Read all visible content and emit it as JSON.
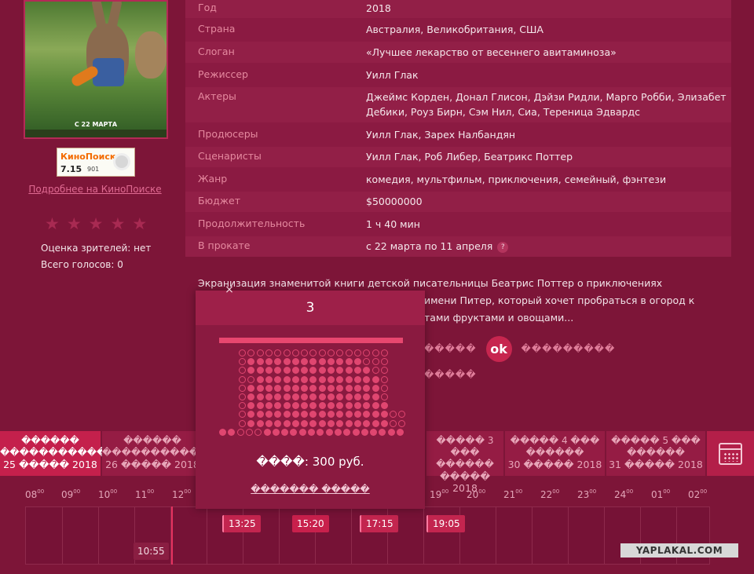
{
  "poster": {
    "date_text": "С 22 МАРТА"
  },
  "kinopoisk": {
    "brand": "КиноПоиск",
    "rating": "7.15",
    "votes": "901",
    "link_label": "Подробнее на КиноПоиске"
  },
  "audience": {
    "stars_total": 5,
    "stars_filled": 0,
    "rating_label": "Оценка зрителей: нет",
    "votes_label": "Всего голосов: 0"
  },
  "info": [
    {
      "label": "Год",
      "value": "2018"
    },
    {
      "label": "Страна",
      "value": "Австралия, Великобритания, США"
    },
    {
      "label": "Слоган",
      "value": "«Лучшее лекарство от весеннего авитаминоза»"
    },
    {
      "label": "Режиссер",
      "value": "Уилл Глак"
    },
    {
      "label": "Актеры",
      "value": "Джеймс Корден, Донал Глисон, Дэйзи Ридли, Марго Робби, Элизабет Дебики, Роуз Бирн, Сэм Нил, Сиа, Тереница Эдвардс"
    },
    {
      "label": "Продюсеры",
      "value": "Уилл Глак, Зарех Налбандян"
    },
    {
      "label": "Сценаристы",
      "value": "Уилл Глак, Роб Либер, Беатрикс Поттер"
    },
    {
      "label": "Жанр",
      "value": "комедия, мультфильм, приключения, семейный, фэнтези"
    },
    {
      "label": "Бюджет",
      "value": "$50000000"
    },
    {
      "label": "Продолжительность",
      "value": "1 ч 40 мин"
    },
    {
      "label": "В прокате",
      "value": "с 22 марта по 11 апреля"
    }
  ],
  "help_badge": "?",
  "description": {
    "line1": "Экранизация знаменитой книги детской писательницы Беатрис Поттер о приключениях",
    "line2": "имени Питер, который хочет пробраться в огород к",
    "line3": "тами фруктами и овощами..."
  },
  "share": {
    "left": "�����",
    "right": "���������",
    "second": "�����",
    "ok_icon": "ok-icon"
  },
  "dates": [
    {
      "top": "������",
      "mid": "�����������",
      "date": "25 ����� 2018",
      "active": true
    },
    {
      "top": "������",
      "mid": "�����������",
      "date": "26 ����� 2018",
      "active": false
    },
    {
      "top": "����� 3 ���",
      "mid": "������",
      "date": "����� 2018",
      "active": false
    },
    {
      "top": "����� 4 ���",
      "mid": "������",
      "date": "30 ����� 2018",
      "active": false
    },
    {
      "top": "����� 5 ���",
      "mid": "������",
      "date": "31 ����� 2018",
      "active": false
    }
  ],
  "hours": [
    "08",
    "09",
    "10",
    "11",
    "12",
    "19",
    "20",
    "21",
    "22",
    "23",
    "24",
    "01",
    "02"
  ],
  "sessions": [
    "13:25",
    "15:20",
    "17:15",
    "19:05"
  ],
  "now_time": "10:55",
  "popup": {
    "hall": "3",
    "close": "×",
    "price": "����: 300 руб.",
    "buy_label": "������� �����"
  },
  "watermark": "YAPLAKAL.COM"
}
